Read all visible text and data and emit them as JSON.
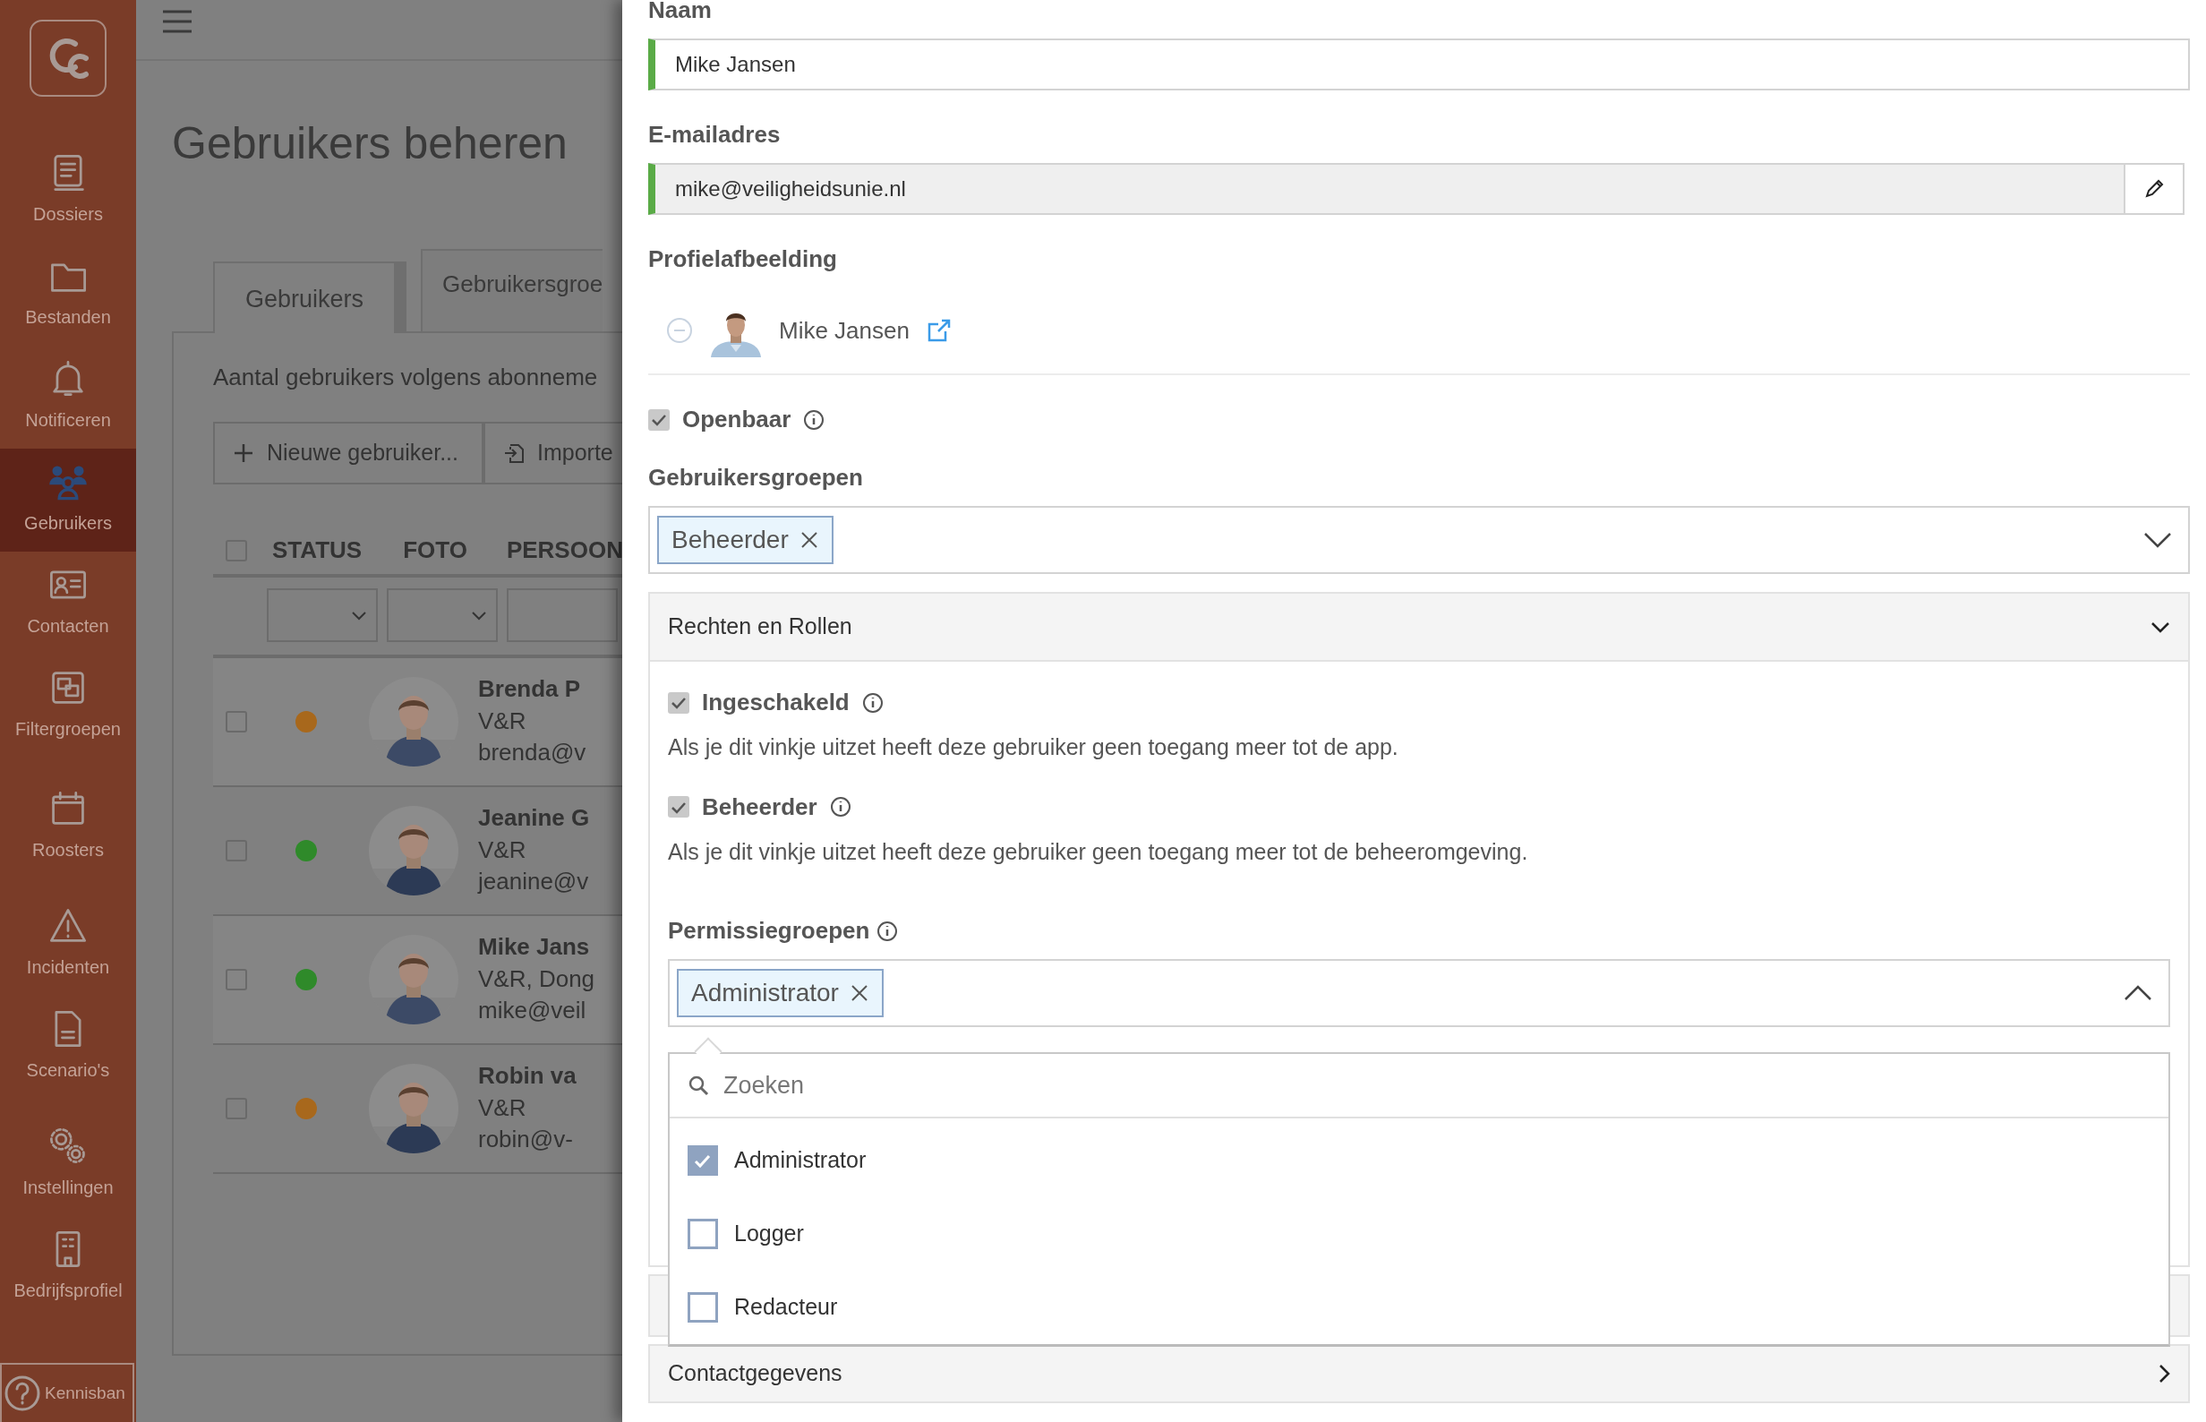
{
  "sidebar": {
    "items": [
      {
        "label": "Dossiers",
        "selected": false
      },
      {
        "label": "Bestanden",
        "selected": false
      },
      {
        "label": "Notificeren",
        "selected": false
      },
      {
        "label": "Gebruikers",
        "selected": true
      },
      {
        "label": "Contacten",
        "selected": false
      },
      {
        "label": "Filtergroepen",
        "selected": false
      },
      {
        "label": "Roosters",
        "selected": false
      },
      {
        "label": "Incidenten",
        "selected": false
      },
      {
        "label": "Scenario's",
        "selected": false
      },
      {
        "label": "Instellingen",
        "selected": false
      },
      {
        "label": "Bedrijfsprofiel",
        "selected": false
      }
    ],
    "help": {
      "label": "Kennisban"
    }
  },
  "background_page": {
    "title": "Gebruikers beheren",
    "tabs": [
      {
        "label": "Gebruikers",
        "selected": true
      },
      {
        "label": "Gebruikersgroe",
        "selected": false
      }
    ],
    "subscription_text": "Aantal gebruikers volgens abonneme",
    "buttons": [
      "Nieuwe gebruiker...",
      "Importe"
    ],
    "table": {
      "all_checked": false,
      "columns": [
        "STATUS",
        "FOTO",
        "PERSOON"
      ],
      "rows": [
        {
          "checked": false,
          "color": "#a8681c",
          "name": "Brenda P",
          "groups": "V&R",
          "email": "brenda@v"
        },
        {
          "checked": false,
          "color": "#2f8a2a",
          "name": "Jeanine G",
          "groups": "V&R",
          "email": "jeanine@v"
        },
        {
          "checked": false,
          "color": "#2f8a2a",
          "name": "Mike Jans",
          "groups": "V&R, Dong",
          "email": "mike@veil"
        },
        {
          "checked": false,
          "color": "#a8681c",
          "name": "Robin va",
          "groups": "V&R",
          "email": "robin@v-"
        }
      ]
    }
  },
  "form": {
    "name": {
      "label": "Naam",
      "value": "Mike Jansen"
    },
    "email": {
      "label": "E-mailadres",
      "value": "mike@veiligheidsunie.nl"
    },
    "profile_image": {
      "label": "Profielafbeelding",
      "file_name": "Mike Jansen"
    },
    "public": {
      "label": "Openbaar",
      "checked": true
    },
    "user_groups": {
      "label": "Gebruikersgroepen",
      "tags": [
        "Beheerder"
      ],
      "expanded": false
    },
    "sections": [
      {
        "title": "Rechten en Rollen",
        "expanded": true,
        "options": [
          {
            "label": "Ingeschakeld",
            "checked": true,
            "help": "Als je dit vinkje uitzet heeft deze gebruiker geen toegang meer tot de app."
          },
          {
            "label": "Beheerder",
            "checked": true,
            "help": "Als je dit vinkje uitzet heeft deze gebruiker geen toegang meer tot de beheeromgeving."
          }
        ],
        "permission_groups": {
          "label": "Permissiegroepen",
          "tags": [
            "Administrator"
          ],
          "expanded": true,
          "dropdown": {
            "search_placeholder": "Zoeken",
            "options": [
              {
                "label": "Administrator",
                "checked": true
              },
              {
                "label": "Logger",
                "checked": false
              },
              {
                "label": "Redacteur",
                "checked": false
              }
            ]
          }
        }
      },
      {
        "expanded": false
      },
      {
        "title": "Contactgegevens",
        "expanded": false
      }
    ]
  }
}
